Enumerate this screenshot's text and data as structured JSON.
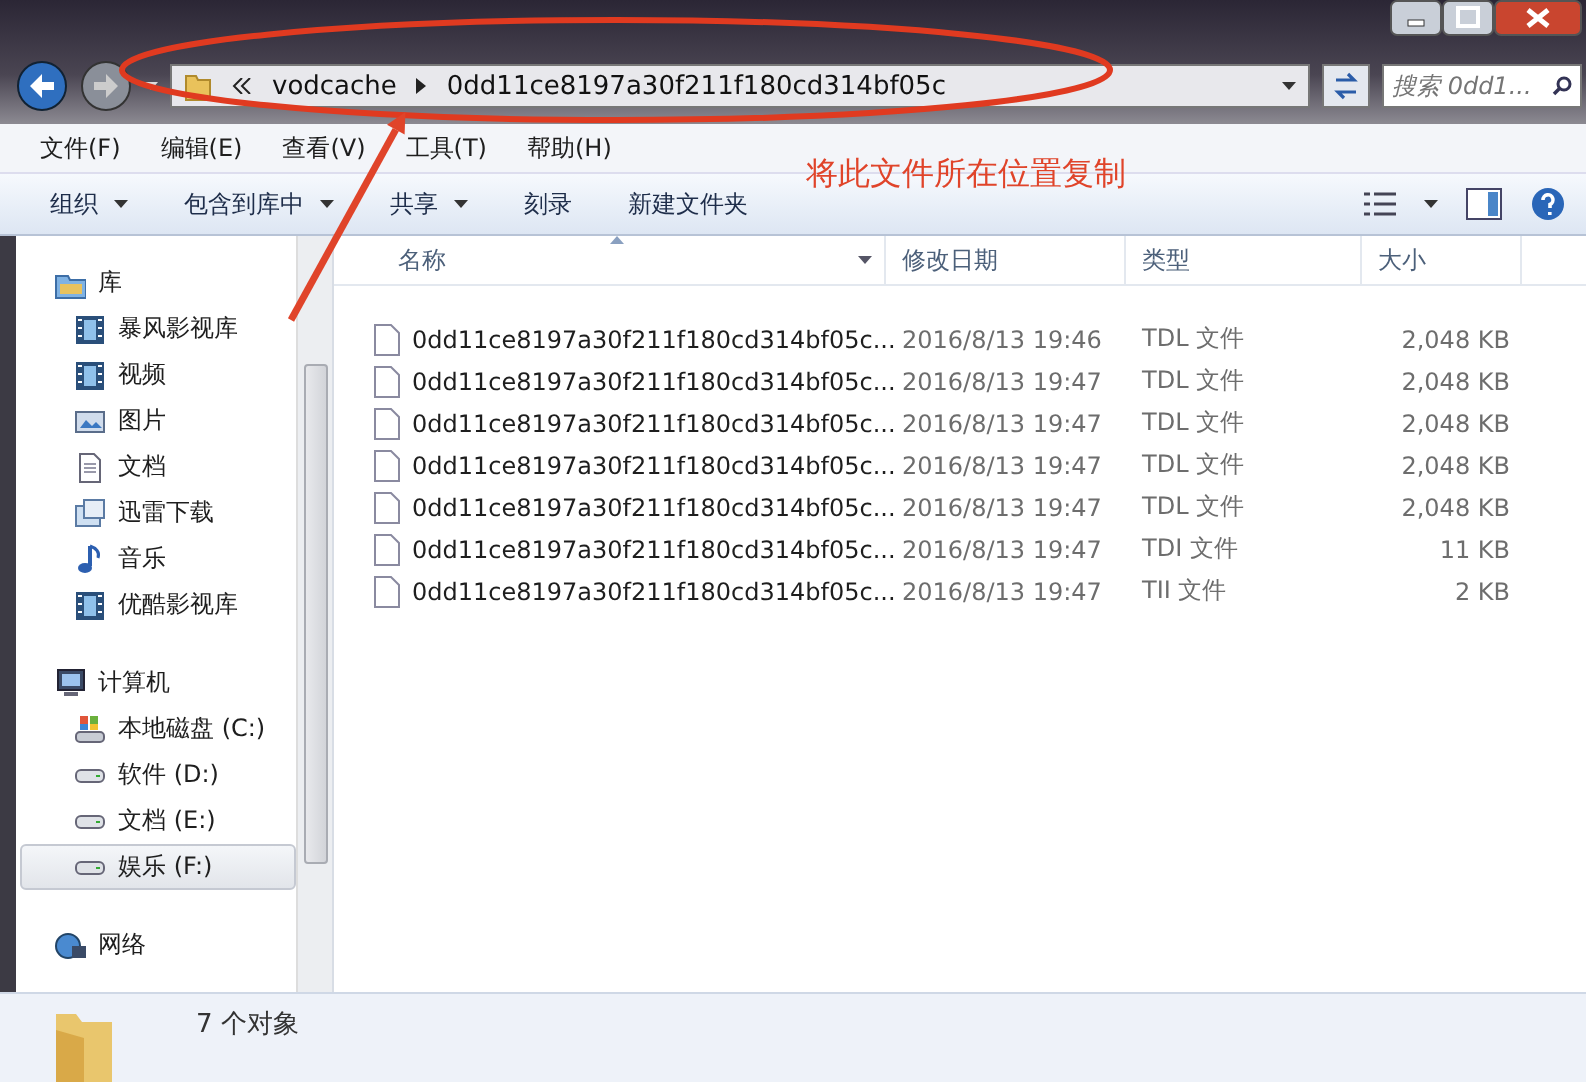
{
  "address": {
    "segments": [
      "vodcache",
      "0dd11ce8197a30f211f180cd314bf05c"
    ]
  },
  "search": {
    "placeholder": "搜索 0dd1..."
  },
  "menu": [
    "文件(F)",
    "编辑(E)",
    "查看(V)",
    "工具(T)",
    "帮助(H)"
  ],
  "toolbar": [
    {
      "label": "组织",
      "dropdown": true
    },
    {
      "label": "包含到库中",
      "dropdown": true
    },
    {
      "label": "共享",
      "dropdown": true
    },
    {
      "label": "刻录",
      "dropdown": false
    },
    {
      "label": "新建文件夹",
      "dropdown": false
    }
  ],
  "nav": {
    "groups": [
      {
        "label": "库",
        "kind": "library",
        "selected": false,
        "children": [
          {
            "label": "暴风影视库",
            "kind": "video",
            "selected": false
          },
          {
            "label": "视频",
            "kind": "video",
            "selected": false
          },
          {
            "label": "图片",
            "kind": "pictures",
            "selected": false
          },
          {
            "label": "文档",
            "kind": "document",
            "selected": false
          },
          {
            "label": "迅雷下载",
            "kind": "download",
            "selected": false
          },
          {
            "label": "音乐",
            "kind": "music",
            "selected": false
          },
          {
            "label": "优酷影视库",
            "kind": "video",
            "selected": false
          }
        ]
      },
      {
        "label": "计算机",
        "kind": "computer",
        "selected": false,
        "children": [
          {
            "label": "本地磁盘 (C:)",
            "kind": "system-drive",
            "selected": false
          },
          {
            "label": "软件 (D:)",
            "kind": "drive",
            "selected": false
          },
          {
            "label": "文档 (E:)",
            "kind": "drive",
            "selected": false
          },
          {
            "label": "娱乐 (F:)",
            "kind": "drive",
            "selected": true
          }
        ]
      },
      {
        "label": "网络",
        "kind": "network",
        "selected": false
      }
    ]
  },
  "table": {
    "columns": [
      {
        "label": "名称",
        "sorted": true
      },
      {
        "label": "修改日期",
        "sorted": false
      },
      {
        "label": "类型",
        "sorted": false
      },
      {
        "label": "大小",
        "sorted": false
      }
    ],
    "rows": [
      [
        "0dd11ce8197a30f211f180cd314bf05c...",
        "2016/8/13 19:46",
        "TDL 文件",
        "2,048 KB"
      ],
      [
        "0dd11ce8197a30f211f180cd314bf05c...",
        "2016/8/13 19:47",
        "TDL 文件",
        "2,048 KB"
      ],
      [
        "0dd11ce8197a30f211f180cd314bf05c...",
        "2016/8/13 19:47",
        "TDL 文件",
        "2,048 KB"
      ],
      [
        "0dd11ce8197a30f211f180cd314bf05c...",
        "2016/8/13 19:47",
        "TDL 文件",
        "2,048 KB"
      ],
      [
        "0dd11ce8197a30f211f180cd314bf05c...",
        "2016/8/13 19:47",
        "TDL 文件",
        "2,048 KB"
      ],
      [
        "0dd11ce8197a30f211f180cd314bf05c...",
        "2016/8/13 19:47",
        "TDI 文件",
        "11 KB"
      ],
      [
        "0dd11ce8197a30f211f180cd314bf05c...",
        "2016/8/13 19:47",
        "TII 文件",
        "2 KB"
      ]
    ]
  },
  "status_bar": {
    "count": "7 个对象"
  },
  "annotation": {
    "text": "将此文件所在位置复制"
  }
}
